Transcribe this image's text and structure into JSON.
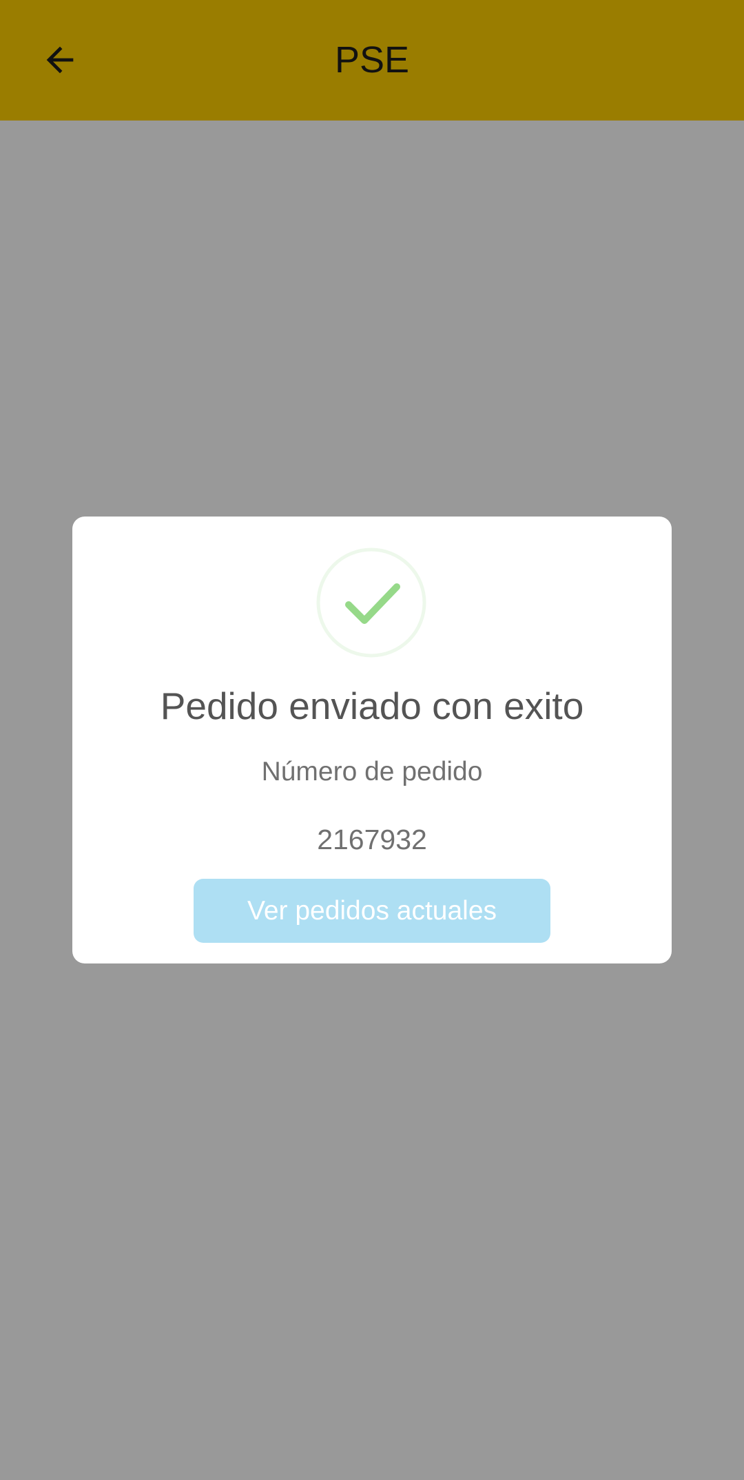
{
  "app_bar": {
    "title": "PSE",
    "back_icon": "arrow-left-icon",
    "background_color": "#9a7d00"
  },
  "dialog": {
    "status_icon": "check-circle-icon",
    "title": "Pedido enviado con exito",
    "order_label": "Número de pedido",
    "order_number": "2167932",
    "button_label": "Ver pedidos actuales",
    "colors": {
      "success": "#96d989",
      "success_ring": "#edf8eb",
      "button": "#aedff3"
    }
  },
  "scrim_color": "#999999"
}
